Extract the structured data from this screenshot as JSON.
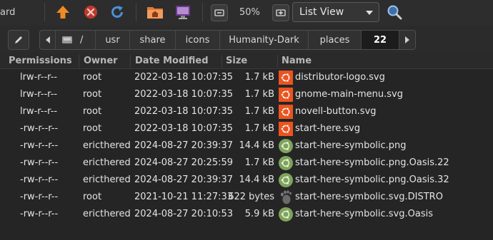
{
  "toolbar": {
    "partial_label": "ard",
    "zoom": "50%",
    "view_mode": "List View"
  },
  "pathbar": {
    "crumbs": [
      "/",
      "usr",
      "share",
      "icons",
      "Humanity-Dark",
      "places",
      "22"
    ]
  },
  "columns": {
    "permissions": "Permissions",
    "owner": "Owner",
    "date": "Date Modified",
    "size": "Size",
    "name": "Name"
  },
  "files": [
    {
      "perm": "lrw-r--r--",
      "owner": "root",
      "date": "2022-03-18 10:07:35",
      "size": "1.7 kB",
      "name": "distributor-logo.svg",
      "icon": "ubuntu-logo-icon"
    },
    {
      "perm": "lrw-r--r--",
      "owner": "root",
      "date": "2022-03-18 10:07:35",
      "size": "1.7 kB",
      "name": "gnome-main-menu.svg",
      "icon": "ubuntu-logo-icon"
    },
    {
      "perm": "lrw-r--r--",
      "owner": "root",
      "date": "2022-03-18 10:07:35",
      "size": "1.7 kB",
      "name": "novell-button.svg",
      "icon": "ubuntu-logo-icon"
    },
    {
      "perm": "-rw-r--r--",
      "owner": "root",
      "date": "2022-03-18 10:07:35",
      "size": "1.7 kB",
      "name": "start-here.svg",
      "icon": "ubuntu-logo-icon"
    },
    {
      "perm": "-rw-r--r--",
      "owner": "ericthered",
      "date": "2024-08-27 20:39:37",
      "size": "14.4 kB",
      "name": "start-here-symbolic.png",
      "icon": "symbolic-logo-icon"
    },
    {
      "perm": "-rw-r--r--",
      "owner": "ericthered",
      "date": "2024-08-27 20:25:59",
      "size": "1.7 kB",
      "name": "start-here-symbolic.png.Oasis.22",
      "icon": "symbolic-logo-icon"
    },
    {
      "perm": "-rw-r--r--",
      "owner": "ericthered",
      "date": "2024-08-27 20:39:37",
      "size": "14.4 kB",
      "name": "start-here-symbolic.png.Oasis.32",
      "icon": "symbolic-logo-icon"
    },
    {
      "perm": "-rw-r--r--",
      "owner": "root",
      "date": "2021-10-21 11:27:33",
      "size": "622 bytes",
      "name": "start-here-symbolic.svg.DISTRO",
      "icon": "gnome-foot-icon"
    },
    {
      "perm": "-rw-r--r--",
      "owner": "ericthered",
      "date": "2024-08-27 20:10:53",
      "size": "5.9 kB",
      "name": "start-here-symbolic.svg.Oasis",
      "icon": "symbolic-logo-icon"
    }
  ],
  "colors": {
    "ubuntu_orange": "#e95420",
    "symbolic_green": "#7ea45c",
    "up_orange": "#f08a24",
    "stop_red": "#c0392b",
    "reload_blue": "#4a90d9"
  }
}
